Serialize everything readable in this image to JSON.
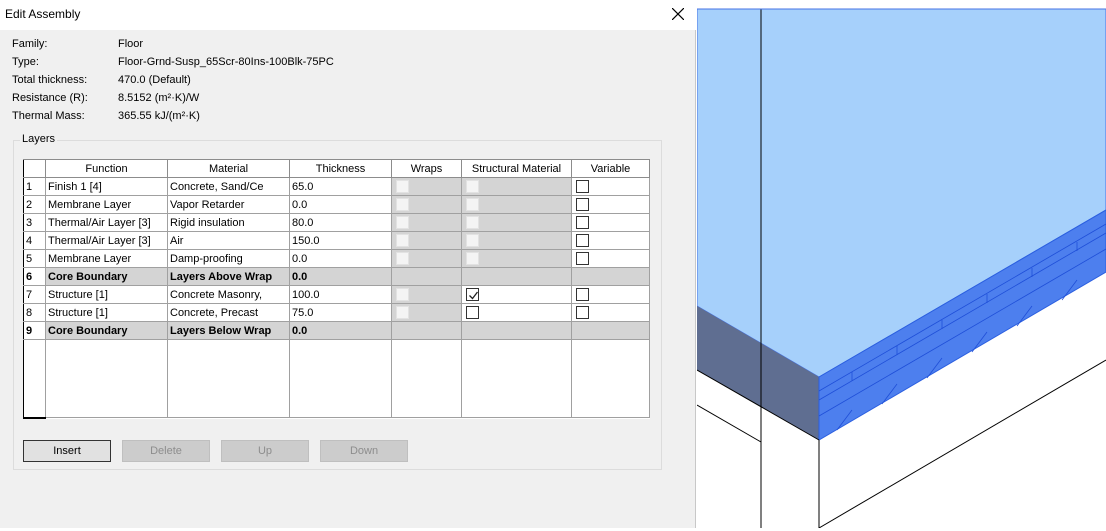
{
  "dialog": {
    "title": "Edit Assembly",
    "close_label": "close"
  },
  "properties": [
    {
      "label": "Family:",
      "value": "Floor"
    },
    {
      "label": "Type:",
      "value": "Floor-Grnd-Susp_65Scr-80Ins-100Blk-75PC"
    },
    {
      "label": "Total thickness:",
      "value": "470.0 (Default)"
    },
    {
      "label": "Resistance (R):",
      "value": "8.5152 (m²·K)/W"
    },
    {
      "label": "Thermal Mass:",
      "value": "365.55 kJ/(m²·K)"
    }
  ],
  "layers": {
    "group_label": "Layers",
    "columns": [
      "Function",
      "Material",
      "Thickness",
      "Wraps",
      "Structural Material",
      "Variable"
    ],
    "rows": [
      {
        "num": "1",
        "function": "Finish 1 [4]",
        "material": "Concrete, Sand/Ce",
        "thickness": "65.0",
        "structural": false,
        "variable": false
      },
      {
        "num": "2",
        "function": "Membrane Layer",
        "material": "Vapor Retarder",
        "thickness": "0.0",
        "structural": false,
        "variable": false
      },
      {
        "num": "3",
        "function": "Thermal/Air Layer [3]",
        "material": "Rigid insulation",
        "thickness": "80.0",
        "structural": false,
        "variable": false
      },
      {
        "num": "4",
        "function": "Thermal/Air Layer [3]",
        "material": "Air",
        "thickness": "150.0",
        "structural": false,
        "variable": false
      },
      {
        "num": "5",
        "function": "Membrane Layer",
        "material": "Damp-proofing",
        "thickness": "0.0",
        "structural": false,
        "variable": false
      },
      {
        "num": "6",
        "function": "Core Boundary",
        "material": "Layers Above Wrap",
        "thickness": "0.0"
      },
      {
        "num": "7",
        "function": "Structure [1]",
        "material": "Concrete Masonry,",
        "thickness": "100.0",
        "structural": true,
        "variable": false
      },
      {
        "num": "8",
        "function": "Structure [1]",
        "material": "Concrete, Precast",
        "thickness": "75.0",
        "structural": false,
        "variable": false
      },
      {
        "num": "9",
        "function": "Core Boundary",
        "material": "Layers Below Wrap",
        "thickness": "0.0"
      }
    ]
  },
  "buttons": {
    "insert": "Insert",
    "delete": "Delete",
    "up": "Up",
    "down": "Down"
  },
  "colors": {
    "dialog_bg": "#f0f0f0",
    "disabled_cell": "#d4d4d4",
    "slab_top": "#a6d0fb",
    "slab_edge": "#4573e6",
    "slab_side": "#5f6e91"
  }
}
